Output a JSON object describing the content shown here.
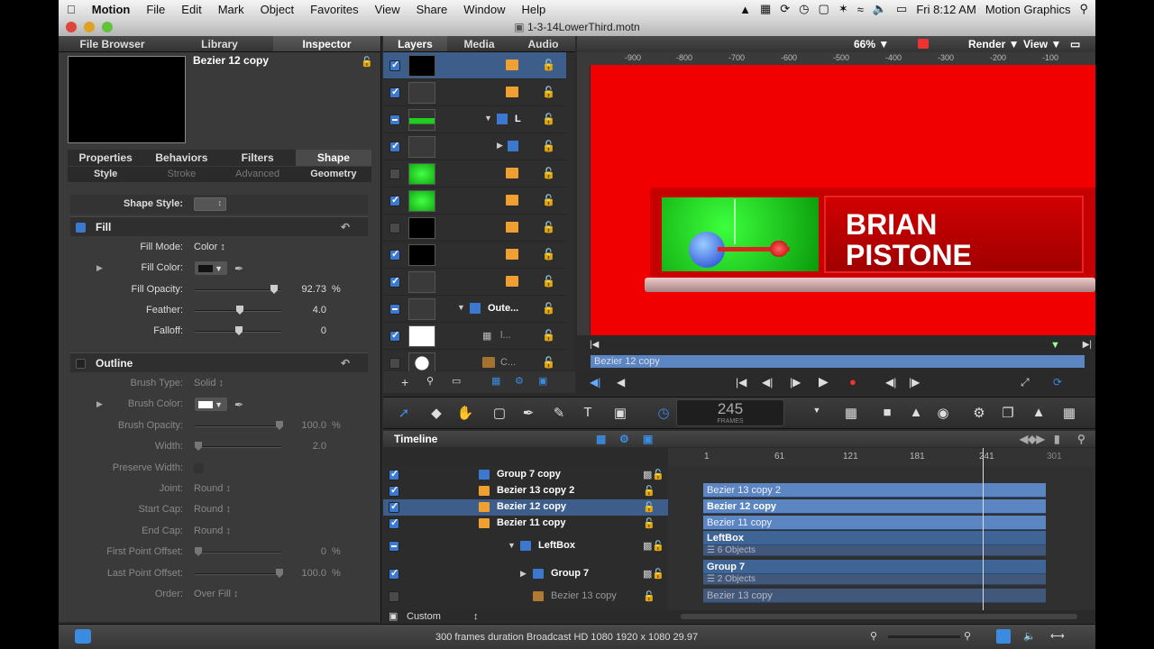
{
  "menubar": {
    "app": "Motion",
    "items": [
      "File",
      "Edit",
      "Mark",
      "Object",
      "Favorites",
      "View",
      "Share",
      "Window",
      "Help"
    ],
    "clock": "Fri 8:12 AM",
    "user": "Motion Graphics"
  },
  "window": {
    "title": "1-3-14LowerThird.motn"
  },
  "left_tabs": [
    "File Browser",
    "Library",
    "Inspector"
  ],
  "inspector": {
    "object_name": "Bezier 12 copy",
    "tabs": [
      "Properties",
      "Behaviors",
      "Filters",
      "Shape"
    ],
    "subtabs": [
      "Style",
      "Stroke",
      "Advanced",
      "Geometry"
    ],
    "shape_style_label": "Shape Style:",
    "fill": {
      "header": "Fill",
      "fill_mode_label": "Fill Mode:",
      "fill_mode": "Color",
      "fill_color_label": "Fill Color:",
      "fill_color": "#111111",
      "fill_opacity_label": "Fill Opacity:",
      "fill_opacity": "92.73",
      "fill_opacity_unit": "%",
      "feather_label": "Feather:",
      "feather": "4.0",
      "falloff_label": "Falloff:",
      "falloff": "0"
    },
    "outline": {
      "header": "Outline",
      "brush_type_label": "Brush Type:",
      "brush_type": "Solid",
      "brush_color_label": "Brush Color:",
      "brush_color": "#ffffff",
      "brush_opacity_label": "Brush Opacity:",
      "brush_opacity": "100.0",
      "brush_opacity_unit": "%",
      "width_label": "Width:",
      "width": "2.0",
      "preserve_width_label": "Preserve Width:",
      "joint_label": "Joint:",
      "joint": "Round",
      "start_cap_label": "Start Cap:",
      "start_cap": "Round",
      "end_cap_label": "End Cap:",
      "end_cap": "Round",
      "first_offset_label": "First Point Offset:",
      "first_offset": "0",
      "first_offset_unit": "%",
      "last_offset_label": "Last Point Offset:",
      "last_offset": "100.0",
      "last_offset_unit": "%",
      "order_label": "Order:",
      "order": "Over Fill"
    }
  },
  "layers_tabs": [
    "Layers",
    "Media",
    "Audio"
  ],
  "layers": [
    {
      "short": ""
    },
    {
      "short": ""
    },
    {
      "short": "L"
    },
    {
      "short": ""
    },
    {
      "short": ""
    },
    {
      "short": ""
    },
    {
      "short": ""
    },
    {
      "short": ""
    },
    {
      "short": ""
    },
    {
      "short": "Oute..."
    },
    {
      "short": "l..."
    },
    {
      "short": "C..."
    }
  ],
  "canvas": {
    "zoom": "66%",
    "render": "Render",
    "view": "View",
    "ruler_ticks": [
      "-900",
      "-800",
      "-700",
      "-600",
      "-500",
      "-400",
      "-300",
      "-200",
      "-100"
    ],
    "name_line1": "BRIAN",
    "name_line2": "PISTONE",
    "mini_timeline_label": "Bezier 12 copy"
  },
  "frames": {
    "value": "245",
    "label": "FRAMES"
  },
  "timeline": {
    "title": "Timeline",
    "ruler": [
      "1",
      "61",
      "121",
      "181",
      "241",
      "301"
    ],
    "rows": [
      {
        "name": "Group 7 copy"
      },
      {
        "name": "Bezier 13 copy 2"
      },
      {
        "name": "Bezier 12 copy"
      },
      {
        "name": "Bezier 11 copy"
      },
      {
        "name": "LeftBox"
      },
      {
        "name": "Group 7"
      },
      {
        "name": "Bezier 13 copy"
      }
    ],
    "bars": [
      "Bezier 13 copy 2",
      "Bezier 12 copy",
      "Bezier 11 copy",
      "LeftBox",
      "6 Objects",
      "Group 7",
      "2 Objects",
      "Bezier 13 copy"
    ],
    "footer": "Custom"
  },
  "status": {
    "text": "300 frames duration Broadcast HD 1080 1920 x 1080 29.97"
  }
}
